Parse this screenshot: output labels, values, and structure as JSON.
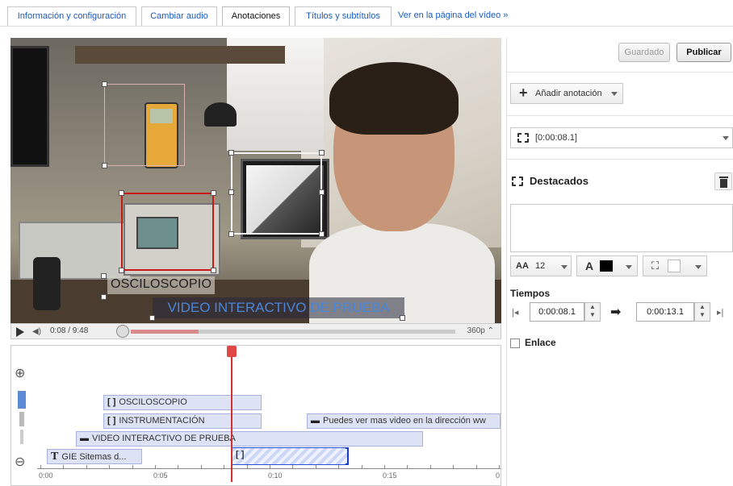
{
  "tabs": {
    "info": "Información y configuración",
    "audio": "Cambiar audio",
    "annotations": "Anotaciones",
    "captions": "Títulos y subtítulos",
    "view_page": "Ver en la página del vídeo »"
  },
  "video": {
    "label_osciloscopio": "OSCILOSCOPIO",
    "label_title": "VIDEO INTERACTIVO DE PRUEBA"
  },
  "player": {
    "time": "0:08 / 9:48",
    "quality": "360p",
    "progress_fraction": 0.21
  },
  "timeline": {
    "items": {
      "osciloscopio": "OSCILOSCOPIO",
      "instrumentacion": "INSTRUMENTACIÓN",
      "video_title": "VIDEO INTERACTIVO DE PRUEBA",
      "speech": "Puedes ver mas video en la dirección ww",
      "gie": "GIE Sitemas d..."
    },
    "ticks": [
      "0:00",
      "0:05",
      "0:10",
      "0:15",
      "0"
    ]
  },
  "panel": {
    "saved_label": "Guardado",
    "publish_label": "Publicar",
    "add_annotation_label": "Añadir anotación",
    "selected_annotation": "[0:00:08.1]",
    "type_heading": "Destacados",
    "font_size": "12",
    "font_icon_label": "A",
    "times_heading": "Tiempos",
    "start_time": "0:00:08.1",
    "end_time": "0:00:13.1",
    "link_label": "Enlace"
  },
  "colors": {
    "accent_blue": "#1a5ab8",
    "highlight_red": "#c81818",
    "playhead_red": "#d43030"
  }
}
